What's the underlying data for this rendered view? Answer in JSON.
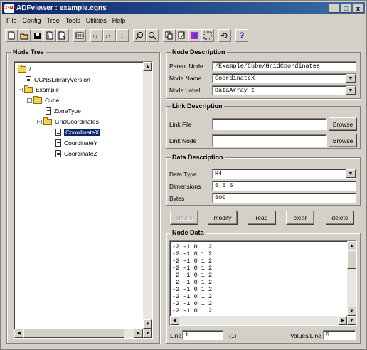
{
  "window": {
    "title": "ADFviewer : example.cgns",
    "icon_text": "CGNS",
    "min": "_",
    "max": "□",
    "close": "x"
  },
  "menu": [
    "File",
    "Config",
    "Tree",
    "Tools",
    "Utilities",
    "Help"
  ],
  "toolbar_icons": [
    "new-icon",
    "open-icon",
    "save-icon",
    "file-info-icon",
    "file-props-icon",
    "grid-icon",
    "link-icon",
    "link2-icon",
    "link3-icon",
    "find-icon",
    "find-next-icon",
    "copy-icon",
    "check-icon",
    "plot-icon",
    "select-icon",
    "refresh-icon",
    "help-icon"
  ],
  "tree": {
    "title": "Node Tree",
    "nodes": [
      {
        "label": "/",
        "type": "folder",
        "expanded": "-"
      },
      {
        "label": "CGNSLibraryVersion",
        "type": "doc"
      },
      {
        "label": "Example",
        "type": "folder",
        "expanded": "-"
      },
      {
        "label": "Cube",
        "type": "folder",
        "expanded": "-"
      },
      {
        "label": "ZoneType",
        "type": "doc"
      },
      {
        "label": "GridCoordinates",
        "type": "folder",
        "expanded": "-"
      },
      {
        "label": "CoordinateX",
        "type": "doc",
        "selected": true
      },
      {
        "label": "CoordinateY",
        "type": "doc"
      },
      {
        "label": "CoordinateZ",
        "type": "doc"
      }
    ]
  },
  "node_description": {
    "title": "Node Description",
    "parent_label": "Parent Node",
    "parent_value": "/Example/Cube/GridCoordinates",
    "name_label": "Node Name",
    "name_value": "CoordinateX",
    "label_label": "Node Label",
    "label_value": "DataArray_t"
  },
  "link_description": {
    "title": "Link Description",
    "file_label": "Link File",
    "file_value": "",
    "node_label": "Link Node",
    "node_value": "",
    "browse": "Browse"
  },
  "data_description": {
    "title": "Data Description",
    "type_label": "Data Type",
    "type_value": "R4",
    "dims_label": "Dimensions",
    "dims_value": "5 5 5",
    "bytes_label": "Bytes",
    "bytes_value": "500"
  },
  "actions": {
    "create": "create",
    "modify": "modify",
    "read": "read",
    "clear": "clear",
    "delete": "delete"
  },
  "node_data": {
    "title": "Node Data",
    "lines": [
      "-2 -1 0 1 2",
      "-2 -1 0 1 2",
      "-2 -1 0 1 2",
      "-2 -1 0 1 2",
      "-2 -1 0 1 2",
      "-2 -1 0 1 2",
      "-2 -1 0 1 2",
      "-2 -1 0 1 2",
      "-2 -1 0 1 2",
      "-2 -1 0 1 2"
    ],
    "line_label": "Line",
    "line_value": "1",
    "line_total": "(1)",
    "values_label": "Values/Line",
    "values_value": "5"
  }
}
